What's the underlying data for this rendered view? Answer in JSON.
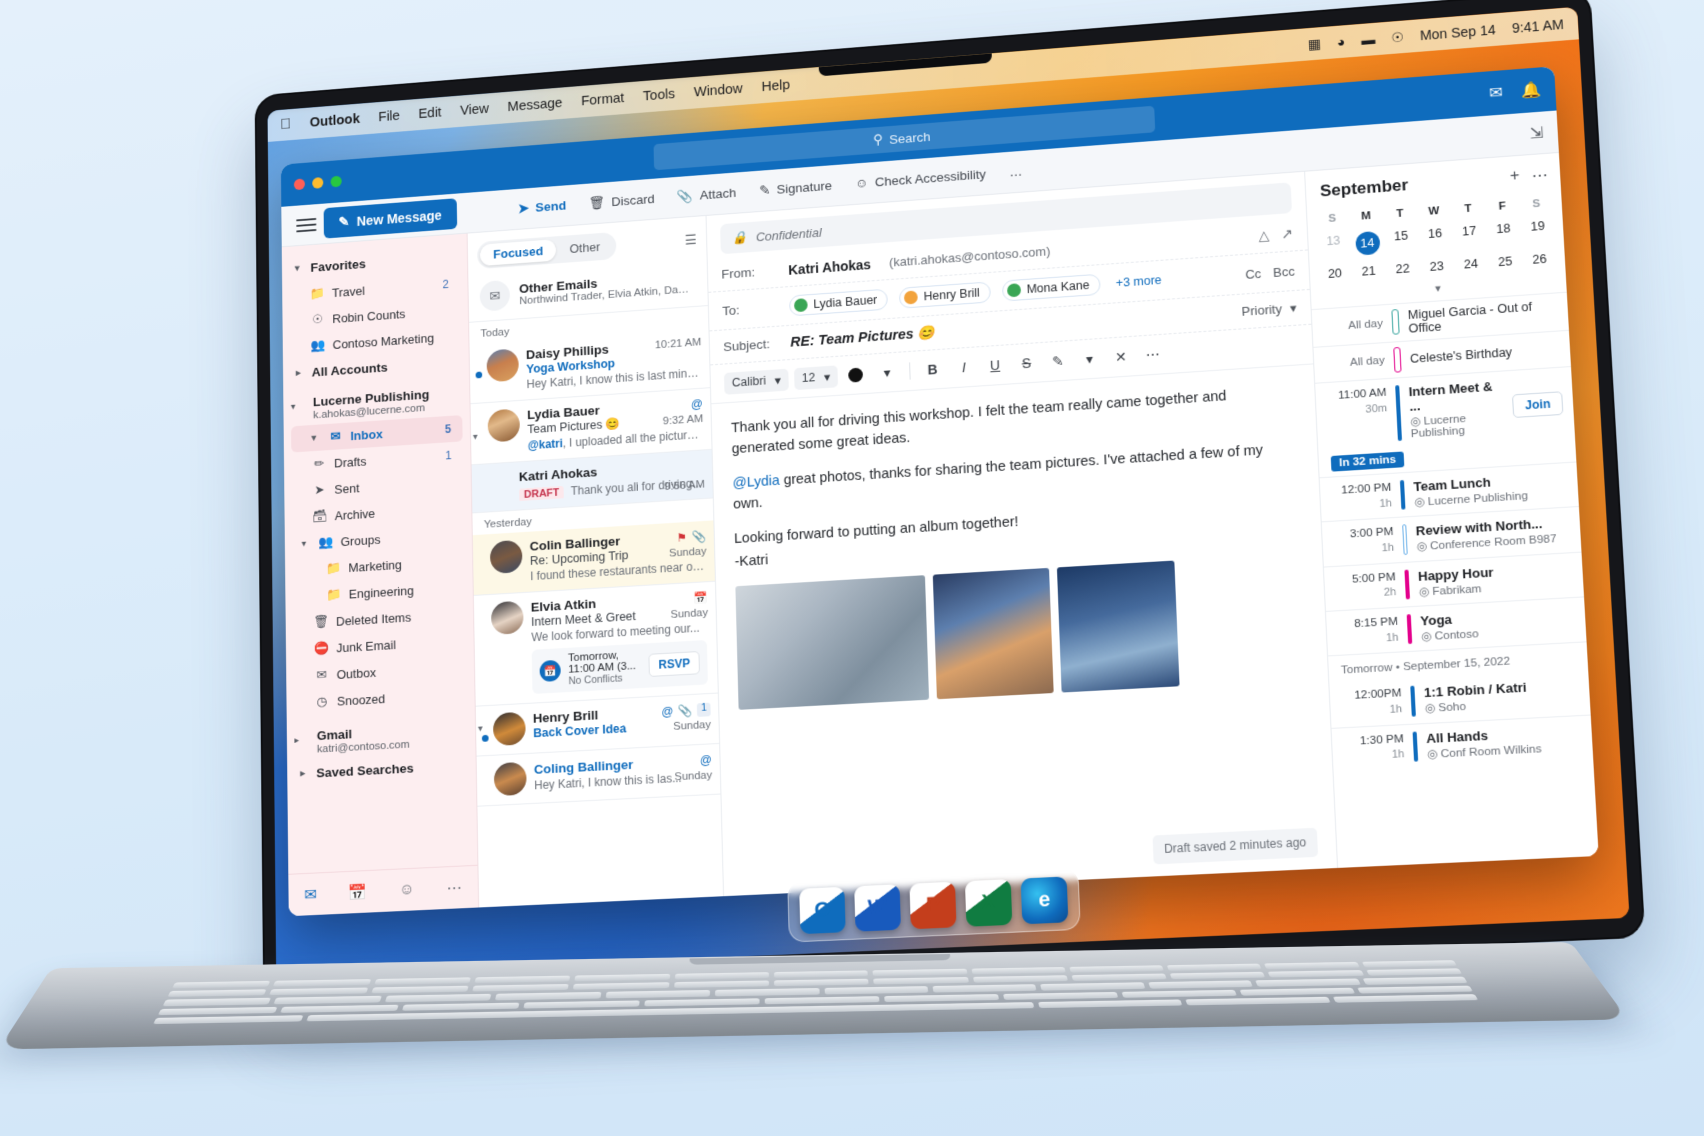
{
  "menubar": {
    "apple_icon": "apple-icon",
    "items": [
      "Outlook",
      "File",
      "Edit",
      "View",
      "Message",
      "Format",
      "Tools",
      "Window",
      "Help"
    ],
    "status_icons": [
      "control-center-icon",
      "wifi-icon",
      "battery-icon",
      "siri-icon"
    ],
    "date": "Mon Sep 14",
    "time": "9:41 AM"
  },
  "titlebar": {
    "search_placeholder": "Search",
    "search_icon": "search-icon",
    "right_icons": [
      "meeting-icon",
      "bell-icon"
    ]
  },
  "ribbon": {
    "menu_icon": "hamburger-icon",
    "new_message": "New Message",
    "new_message_icon": "compose-icon",
    "buttons": [
      {
        "label": "Send",
        "icon": "send-icon"
      },
      {
        "label": "Discard",
        "icon": "trash-icon"
      },
      {
        "label": "Attach",
        "icon": "paperclip-icon"
      },
      {
        "label": "Signature",
        "icon": "signature-icon"
      },
      {
        "label": "Check Accessibility",
        "icon": "accessibility-icon"
      }
    ],
    "overflow": "…",
    "expand_icon": "expand-pane-icon"
  },
  "sidebar": {
    "favorites": {
      "label": "Favorites",
      "items": [
        {
          "label": "Travel",
          "icon": "folder-icon",
          "count": "2"
        },
        {
          "label": "Robin Counts",
          "icon": "person-icon",
          "count": ""
        },
        {
          "label": "Contoso Marketing",
          "icon": "people-icon",
          "count": ""
        }
      ]
    },
    "all_accounts": "All Accounts",
    "account": {
      "name": "Lucerne Publishing",
      "email": "k.ahokas@lucerne.com",
      "folders": [
        {
          "label": "Inbox",
          "icon": "inbox-icon",
          "count": "5",
          "selected": true
        },
        {
          "label": "Drafts",
          "icon": "drafts-icon",
          "count": "1",
          "selected": false
        },
        {
          "label": "Sent",
          "icon": "sent-icon",
          "count": "",
          "selected": false
        },
        {
          "label": "Archive",
          "icon": "archive-icon",
          "count": "",
          "selected": false
        },
        {
          "label": "Groups",
          "icon": "people-icon",
          "count": "",
          "selected": false
        },
        {
          "label": "Marketing",
          "icon": "folder-icon",
          "count": "",
          "selected": false
        },
        {
          "label": "Engineering",
          "icon": "folder-icon",
          "count": "",
          "selected": false
        },
        {
          "label": "Deleted Items",
          "icon": "trash-icon",
          "count": "",
          "selected": false
        },
        {
          "label": "Junk Email",
          "icon": "junk-icon",
          "count": "",
          "selected": false
        },
        {
          "label": "Outbox",
          "icon": "outbox-icon",
          "count": "",
          "selected": false
        },
        {
          "label": "Snoozed",
          "icon": "clock-icon",
          "count": "",
          "selected": false
        }
      ]
    },
    "gmail": {
      "name": "Gmail",
      "email": "katri@contoso.com"
    },
    "saved_searches": "Saved Searches",
    "footer_icons": [
      "mail-icon",
      "calendar-icon",
      "people-icon",
      "more-icon"
    ]
  },
  "messagelist": {
    "pivots": [
      {
        "label": "Focused",
        "active": true
      },
      {
        "label": "Other",
        "active": false
      }
    ],
    "filter_icon": "filter-icon",
    "other_emails": {
      "title": "Other Emails",
      "preview": "Northwind Trader, Elvia Atkin, Daisy Phillips",
      "icon": "envelope-icon"
    },
    "groups": [
      {
        "label": "Today",
        "messages": [
          {
            "sender": "Daisy Phillips",
            "subject": "Yoga Workshop",
            "subject_blue": true,
            "preview": "Hey Katri, I know this is last minutes..",
            "time": "10:21 AM",
            "unread": true,
            "draft": "",
            "avatar": "daisy",
            "flagged": false,
            "selected": false,
            "icons": []
          },
          {
            "sender": "Lydia Bauer",
            "subject": "Team Pictures 😊",
            "subject_blue": false,
            "preview": "@katri, I uploaded all the pictures from...",
            "time": "9:32 AM",
            "unread": false,
            "draft": "",
            "avatar": "lydia",
            "flagged": false,
            "selected": false,
            "icons": [
              "@"
            ],
            "mention": "@katri"
          },
          {
            "sender": "Katri Ahokas",
            "subject": "",
            "subject_blue": false,
            "preview": "Thank you all for driving...",
            "time": "9:56 AM",
            "unread": false,
            "draft": "DRAFT",
            "avatar": "",
            "flagged": false,
            "selected": true,
            "icons": []
          }
        ]
      },
      {
        "label": "Yesterday",
        "messages": [
          {
            "sender": "Colin Ballinger",
            "subject": "Re: Upcoming Trip",
            "subject_blue": false,
            "preview": "I found these restaurants near our hotel...",
            "time": "Sunday",
            "unread": false,
            "draft": "",
            "avatar": "colin",
            "flagged": true,
            "selected": false,
            "icons": [
              "🚩",
              "📎"
            ]
          },
          {
            "sender": "Elvia Atkin",
            "subject": "Intern Meet & Greet",
            "subject_blue": false,
            "preview": "We look forward to meeting our...",
            "time": "Sunday",
            "unread": false,
            "draft": "",
            "avatar": "elvia",
            "flagged": false,
            "selected": false,
            "icons": [
              "calendar-icon"
            ],
            "rsvp": {
              "title": "Tomorrow, 11:00 AM (3...",
              "sub": "No Conflicts",
              "button": "RSVP"
            }
          },
          {
            "sender": "Henry Brill",
            "subject": "Back Cover Idea",
            "subject_blue": true,
            "preview": "",
            "time": "Sunday",
            "unread": true,
            "draft": "",
            "avatar": "henry",
            "flagged": false,
            "selected": false,
            "icons": [
              "@",
              "📎",
              "1"
            ]
          },
          {
            "sender": "Coling Ballinger",
            "subject": "",
            "subject_blue": true,
            "preview": "Hey Katri, I know this is las...",
            "time": "Sunday",
            "unread": false,
            "draft": "",
            "avatar": "coling",
            "flagged": false,
            "selected": false,
            "icons": [
              "@"
            ]
          }
        ]
      }
    ]
  },
  "compose": {
    "sensitivity": "Confidential",
    "sensitivity_icon": "lock-icon",
    "from_label": "From:",
    "from_name": "Katri Ahokas",
    "from_email": "(katri.ahokas@contoso.com)",
    "from_icons": [
      "collapse-icon",
      "popout-icon"
    ],
    "to_label": "To:",
    "recipients": [
      {
        "name": "Lydia Bauer",
        "presence": "green"
      },
      {
        "name": "Henry Brill",
        "presence": "orange"
      },
      {
        "name": "Mona Kane",
        "presence": "green"
      }
    ],
    "more_recipients": "+3 more",
    "cc": "Cc",
    "bcc": "Bcc",
    "subject_label": "Subject:",
    "subject": "RE: Team Pictures 😊",
    "priority": "Priority",
    "format": {
      "font": "Calibri",
      "size": "12",
      "color": "#111111",
      "buttons": [
        "B",
        "I",
        "U",
        "S",
        "highlight",
        "clear-formatting",
        "more"
      ]
    },
    "body_paragraphs": [
      "Thank you all for driving this workshop. I felt the team really came together and generated some great ideas.",
      "@Lydia great photos, thanks for sharing the team pictures. I've attached a few of my own.",
      "Looking forward to putting an album together!",
      "-Katri"
    ],
    "body_mention": "@Lydia",
    "attachments": [
      "photo-architecture",
      "photo-cityscape",
      "photo-harbor"
    ],
    "saved_status": "Draft saved 2 minutes ago"
  },
  "calendar": {
    "month": "September",
    "add_icon": "plus-icon",
    "more_icon": "more-icon",
    "dow": [
      "S",
      "M",
      "T",
      "W",
      "T",
      "F",
      "S"
    ],
    "week1": [
      "13",
      "14",
      "15",
      "16",
      "17",
      "18",
      "19"
    ],
    "week2": [
      "20",
      "21",
      "22",
      "23",
      "24",
      "25",
      "26"
    ],
    "today": "14",
    "expand_icon": "chevron-down-icon",
    "allday": [
      {
        "label": "All day",
        "title": "Miguel Garcia - Out of Office",
        "color": "teal"
      },
      {
        "label": "All day",
        "title": "Celeste's Birthday",
        "color": "pinko"
      }
    ],
    "now_badge": "In 32 mins",
    "events_today": [
      {
        "time": "11:00 AM",
        "dur": "30m",
        "title": "Intern Meet & ...",
        "loc": "Lucerne Publishing",
        "color": "blue",
        "join": "Join",
        "current": true
      },
      {
        "time": "12:00 PM",
        "dur": "1h",
        "title": "Team Lunch",
        "loc": "Lucerne Publishing",
        "color": "blue",
        "join": "",
        "current": false
      },
      {
        "time": "3:00 PM",
        "dur": "1h",
        "title": "Review with North...",
        "loc": "Conference Room B987",
        "color": "lblue",
        "join": "",
        "current": false
      },
      {
        "time": "5:00 PM",
        "dur": "2h",
        "title": "Happy Hour",
        "loc": "Fabrikam",
        "color": "pink",
        "join": "",
        "current": false
      },
      {
        "time": "8:15 PM",
        "dur": "1h",
        "title": "Yoga",
        "loc": "Contoso",
        "color": "pink",
        "join": "",
        "current": false
      }
    ],
    "tomorrow_label": "Tomorrow • September 15, 2022",
    "events_tomorrow": [
      {
        "time": "12:00PM",
        "dur": "1h",
        "title": "1:1 Robin / Katri",
        "loc": "Soho",
        "color": "blue",
        "join": "",
        "current": false
      },
      {
        "time": "1:30 PM",
        "dur": "1h",
        "title": "All Hands",
        "loc": "Conf Room Wilkins",
        "color": "blue",
        "join": "",
        "current": false
      }
    ]
  },
  "dock": {
    "apps": [
      {
        "name": "Outlook",
        "glyph": "O",
        "cls": "outlook"
      },
      {
        "name": "Word",
        "glyph": "W",
        "cls": "word"
      },
      {
        "name": "PowerPoint",
        "glyph": "P",
        "cls": "ppt"
      },
      {
        "name": "Excel",
        "glyph": "X",
        "cls": "excel"
      },
      {
        "name": "Edge",
        "glyph": "e",
        "cls": "edge"
      }
    ]
  },
  "colors": {
    "accent": "#0f6cbd",
    "flag": "#c4314b",
    "pink": "#e3008c"
  }
}
